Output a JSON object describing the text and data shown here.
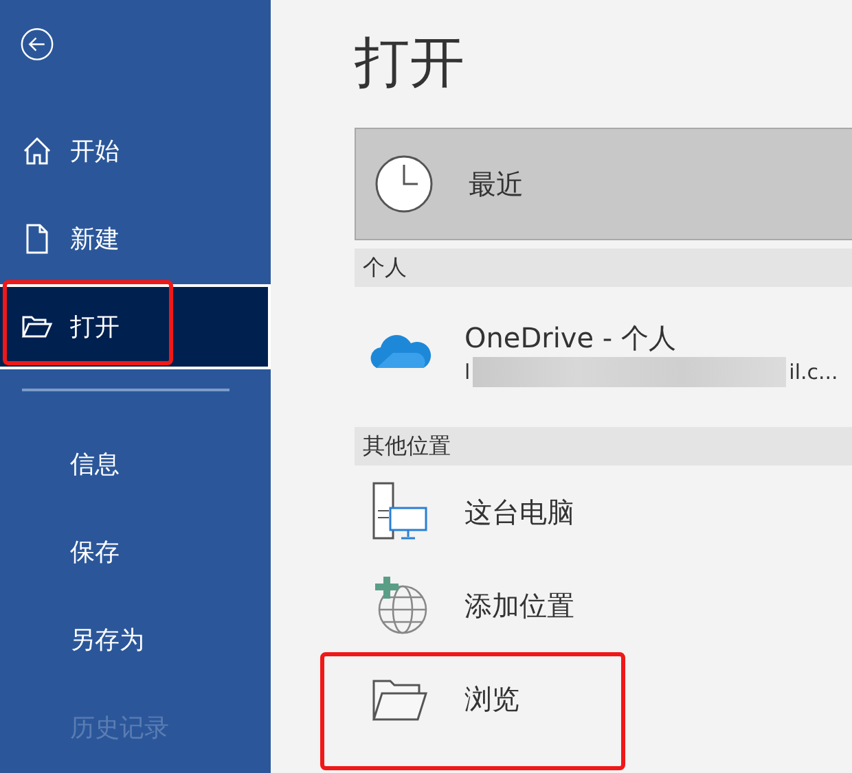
{
  "sidebar": {
    "items": [
      {
        "label": "开始",
        "kind": "home",
        "selected": false,
        "disabled": false,
        "highlighted": false
      },
      {
        "label": "新建",
        "kind": "new",
        "selected": false,
        "disabled": false,
        "highlighted": false
      },
      {
        "label": "打开",
        "kind": "open",
        "selected": true,
        "disabled": false,
        "highlighted": true
      },
      {
        "kind": "divider"
      },
      {
        "label": "信息",
        "kind": "plain",
        "selected": false,
        "disabled": false,
        "highlighted": false
      },
      {
        "label": "保存",
        "kind": "plain",
        "selected": false,
        "disabled": false,
        "highlighted": false
      },
      {
        "label": "另存为",
        "kind": "plain",
        "selected": false,
        "disabled": false,
        "highlighted": false
      },
      {
        "kind": "spacer"
      },
      {
        "label": "历史记录",
        "kind": "plain",
        "selected": false,
        "disabled": true,
        "highlighted": false
      }
    ]
  },
  "page": {
    "title": "打开",
    "recent": {
      "label": "最近",
      "selected": true
    },
    "sections": [
      {
        "header": "个人",
        "locations": [
          {
            "kind": "onedrive",
            "label": "OneDrive - 个人",
            "subtitle_start": "l",
            "subtitle_end": "il.c...",
            "redacted": true,
            "highlighted": false
          }
        ]
      },
      {
        "header": "其他位置",
        "locations": [
          {
            "kind": "computer",
            "label": "这台电脑",
            "highlighted": false
          },
          {
            "kind": "add",
            "label": "添加位置",
            "highlighted": false
          },
          {
            "kind": "browse",
            "label": "浏览",
            "highlighted": true
          }
        ]
      }
    ]
  }
}
